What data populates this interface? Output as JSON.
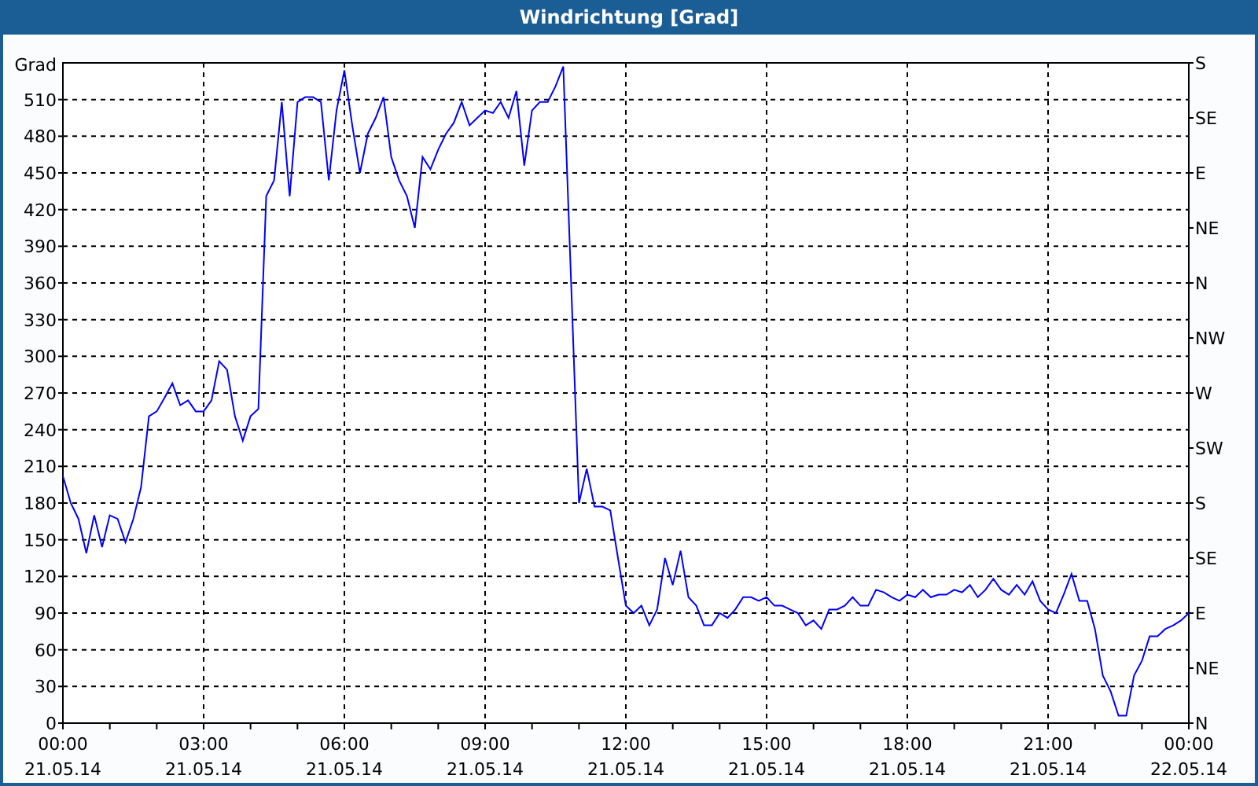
{
  "window": {
    "title": "Windrichtung [Grad]"
  },
  "chart": {
    "chart_data": {
      "type": "line",
      "grid": true,
      "ylabel": "Grad",
      "ylim": [
        0,
        540
      ],
      "categories": [
        "00:00\n21.05.14",
        null,
        null,
        null,
        null,
        null,
        null,
        null,
        null,
        null,
        null,
        null,
        null,
        null,
        null,
        null,
        null,
        null,
        "03:00\n21.05.14",
        null,
        null,
        null,
        null,
        null,
        null,
        null,
        null,
        null,
        null,
        null,
        null,
        null,
        null,
        null,
        null,
        null,
        "06:00\n21.05.14",
        null,
        null,
        null,
        null,
        null,
        null,
        null,
        null,
        null,
        null,
        null,
        null,
        null,
        null,
        null,
        null,
        null,
        "09:00\n21.05.14",
        null,
        null,
        null,
        null,
        null,
        null,
        null,
        null,
        null,
        null,
        null,
        null,
        null,
        null,
        null,
        null,
        null,
        "12:00\n21.05.14",
        null,
        null,
        null,
        null,
        null,
        null,
        null,
        null,
        null,
        null,
        null,
        null,
        null,
        null,
        null,
        null,
        null,
        "15:00\n21.05.14",
        null,
        null,
        null,
        null,
        null,
        null,
        null,
        null,
        null,
        null,
        null,
        null,
        null,
        null,
        null,
        null,
        null,
        "18:00\n21.05.14",
        null,
        null,
        null,
        null,
        null,
        null,
        null,
        null,
        null,
        null,
        null,
        null,
        null,
        null,
        null,
        null,
        null,
        "21:00\n21.05.14",
        null,
        null,
        null,
        null,
        null,
        null,
        null,
        null,
        null,
        null,
        null,
        null,
        null,
        null,
        null,
        null,
        null,
        "00:00\n22.05.14"
      ],
      "yticks": [
        0,
        30,
        60,
        90,
        120,
        150,
        180,
        210,
        240,
        270,
        300,
        330,
        360,
        390,
        420,
        450,
        480,
        510
      ],
      "series": [
        {
          "color": "#0000ff",
          "values": [
            202,
            180,
            167,
            139,
            170,
            144,
            170,
            167,
            148,
            167,
            193,
            251,
            255,
            266,
            278,
            260,
            264,
            255,
            255,
            264,
            296,
            289,
            251,
            231,
            251,
            257,
            431,
            444,
            508,
            431,
            508,
            512,
            512,
            508,
            444,
            501,
            534,
            489,
            450,
            482,
            495,
            512,
            463,
            444,
            431,
            405,
            463,
            453,
            469,
            482,
            491,
            508,
            489,
            495,
            501,
            499,
            508,
            495,
            517,
            456,
            501,
            508,
            508,
            521,
            537,
            360,
            180,
            208,
            177,
            177,
            174,
            135,
            96,
            90,
            96,
            80,
            93,
            135,
            113,
            141,
            103,
            96,
            80,
            80,
            90,
            86,
            93,
            103,
            103,
            100,
            103,
            96,
            96,
            93,
            90,
            80,
            84,
            77,
            93,
            93,
            96,
            103,
            96,
            96,
            109,
            107,
            103,
            100,
            105,
            103,
            109,
            103,
            105,
            105,
            109,
            107,
            113,
            103,
            109,
            118,
            109,
            105,
            113,
            105,
            116,
            100,
            93,
            90,
            105,
            122,
            100,
            100,
            77,
            39,
            26,
            6,
            6,
            39,
            51,
            71,
            71,
            77,
            80,
            84,
            90
          ]
        }
      ]
    },
    "compass_labels": [
      "S",
      "SE",
      "E",
      "NE",
      "N",
      "NW",
      "W",
      "SW",
      "S",
      "SE",
      "E",
      "NE",
      "N"
    ]
  }
}
